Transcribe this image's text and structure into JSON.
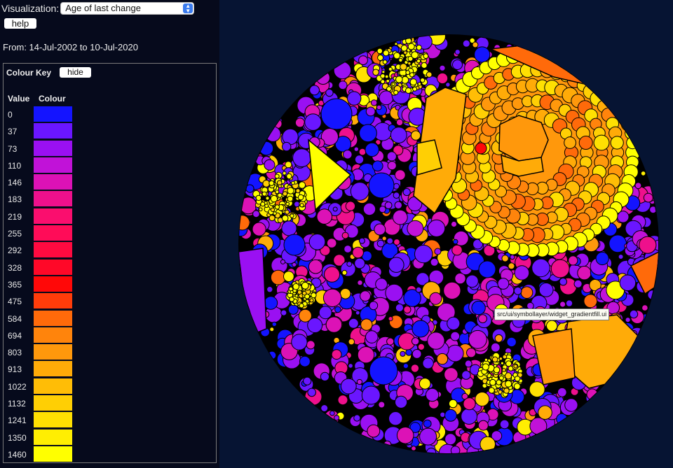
{
  "controls": {
    "visualization_label": "Visualization:",
    "visualization_value": "Age of last change",
    "help_label": "help",
    "date_range": "From: 14-Jul-2002 to 10-Jul-2020"
  },
  "colour_key": {
    "title": "Colour Key",
    "hide_label": "hide",
    "header_value": "Value",
    "header_colour": "Colour",
    "rows": [
      {
        "value": "0",
        "color": "#1414ff"
      },
      {
        "value": "37",
        "color": "#6a16ff"
      },
      {
        "value": "73",
        "color": "#9a10f2"
      },
      {
        "value": "110",
        "color": "#c112d8"
      },
      {
        "value": "146",
        "color": "#dc12b6"
      },
      {
        "value": "183",
        "color": "#ee108c"
      },
      {
        "value": "219",
        "color": "#fa0e6e"
      },
      {
        "value": "255",
        "color": "#ff0c58"
      },
      {
        "value": "292",
        "color": "#ff0a40"
      },
      {
        "value": "328",
        "color": "#ff0828"
      },
      {
        "value": "365",
        "color": "#ff0808"
      },
      {
        "value": "475",
        "color": "#ff3c0a"
      },
      {
        "value": "584",
        "color": "#ff6a0a"
      },
      {
        "value": "694",
        "color": "#ff840c"
      },
      {
        "value": "803",
        "color": "#ff980c"
      },
      {
        "value": "913",
        "color": "#ffab08"
      },
      {
        "value": "1022",
        "color": "#ffbd06"
      },
      {
        "value": "1132",
        "color": "#ffcf04"
      },
      {
        "value": "1241",
        "color": "#ffe002"
      },
      {
        "value": "1350",
        "color": "#ffee02"
      },
      {
        "value": "1460",
        "color": "#ffff00"
      }
    ]
  },
  "tooltip": {
    "text": "src/ui/symbollayer/widget_gradientfill.ui"
  }
}
